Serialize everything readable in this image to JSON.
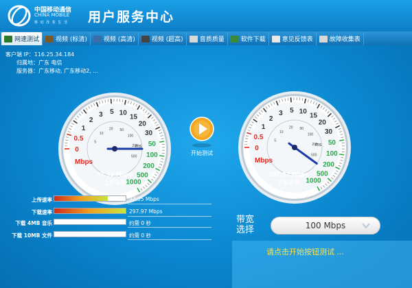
{
  "header": {
    "logo_cn": "中国移动通信",
    "logo_en": "CHINA MOBILE",
    "logo_slogan": "移 动 改 变 生 活",
    "title": "用户服务中心"
  },
  "tabs": [
    {
      "label": "网速测试",
      "icon": "speed-icon",
      "active": true
    },
    {
      "label": "视频 (标清)",
      "icon": "video-icon",
      "active": false
    },
    {
      "label": "视频 (高清)",
      "icon": "video-icon",
      "active": false
    },
    {
      "label": "视频 (超高)",
      "icon": "video-icon",
      "active": false
    },
    {
      "label": "音质质量",
      "icon": "music-icon",
      "active": false
    },
    {
      "label": "软件下载",
      "icon": "download-icon",
      "active": false
    },
    {
      "label": "意见反馈表",
      "icon": "feedback-icon",
      "active": false
    },
    {
      "label": "故障收集表",
      "icon": "report-icon",
      "active": false
    }
  ],
  "client_info": {
    "ip": "客户端 IP：116.25.34.184",
    "location": "归属地：广东 电信",
    "server": "服务器：广东移动, 广东移动2, ..."
  },
  "play_button": {
    "label": "开始测试"
  },
  "upload_gauge": {
    "value_text": "97.35 Mbps",
    "label": "上传速率",
    "unit_mbps": "Mbps",
    "unit_ms": "ms",
    "speed_ticks": [
      "0",
      "0.5",
      "1",
      "2",
      "3",
      "5",
      "10",
      "15",
      "20",
      "30",
      "50",
      "100",
      "200",
      "500",
      "1000"
    ],
    "inner_ticks": [
      "5",
      "10",
      "20",
      "50",
      "100",
      "200",
      "500"
    ]
  },
  "download_gauge": {
    "value_text": "297.97 Mbps",
    "label": "下载速率",
    "unit_mbps": "Mbps",
    "unit_ms": "ms",
    "speed_ticks": [
      "0",
      "0.5",
      "1",
      "2",
      "3",
      "5",
      "10",
      "15",
      "20",
      "30",
      "50",
      "100",
      "200",
      "500",
      "1000"
    ],
    "inner_ticks": [
      "5",
      "10",
      "20",
      "50",
      "100",
      "200",
      "500"
    ]
  },
  "bandwidth": {
    "label": "带宽选择",
    "selected": "100 Mbps"
  },
  "hint": {
    "text": "请点击开始按钮测试 ..."
  },
  "stats": [
    {
      "label": "上传速率",
      "value": "97.35 Mbps",
      "fill": 0.75,
      "colors": [
        "#d22b1c",
        "#f0a020",
        "#c8e63c"
      ]
    },
    {
      "label": "下载速率",
      "value": "297.97 Mbps",
      "fill": 1.0,
      "colors": [
        "#d22b1c",
        "#f0a020",
        "#c8e63c"
      ]
    },
    {
      "label": "下载 4MB 音乐",
      "value": "约需 0 秒",
      "fill": 0,
      "colors": []
    },
    {
      "label": "下载 10MB 文件",
      "value": "约需 0 秒",
      "fill": 0,
      "colors": []
    }
  ],
  "colors": {
    "background": "#0a82c9",
    "hint_text": "#ffe34d",
    "gauge_red": "#e02a1f",
    "gauge_green": "#2aa84a",
    "needle": "#1a3aa8"
  }
}
